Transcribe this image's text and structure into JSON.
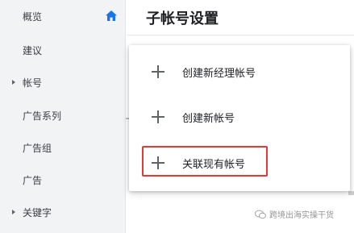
{
  "sidebar": {
    "items": [
      {
        "label": "概览"
      },
      {
        "label": "建议"
      },
      {
        "label": "帐号"
      },
      {
        "label": "广告系列"
      },
      {
        "label": "广告组"
      },
      {
        "label": "广告"
      },
      {
        "label": "关键字"
      }
    ],
    "home_icon": "home-icon",
    "accent_color": "#1a73e8"
  },
  "main": {
    "title": "子帐号设置"
  },
  "menu": {
    "items": [
      {
        "label": "创建新经理帐号",
        "icon": "plus-icon"
      },
      {
        "label": "创建新帐号",
        "icon": "plus-icon"
      },
      {
        "label": "关联现有帐号",
        "icon": "plus-icon",
        "highlighted": true
      }
    ],
    "highlight_color": "#e53935"
  },
  "watermark": {
    "text": "跨境出海实操干货",
    "icon": "wechat-icon"
  }
}
